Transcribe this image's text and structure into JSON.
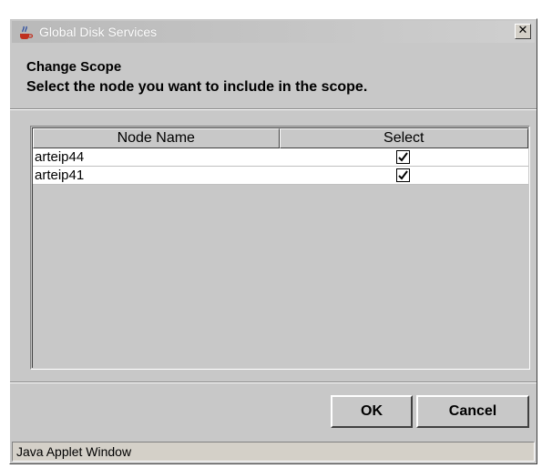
{
  "window": {
    "title": "Global Disk Services",
    "close_glyph": "✕",
    "icon": "java-coffee-cup-icon"
  },
  "dialog": {
    "heading": "Change Scope",
    "instruction": "Select the node you want to include in the scope."
  },
  "table": {
    "columns": [
      "Node Name",
      "Select"
    ],
    "rows": [
      {
        "node_name": "arteip44",
        "selected": true
      },
      {
        "node_name": "arteip41",
        "selected": true
      }
    ]
  },
  "buttons": {
    "ok_label": "OK",
    "cancel_label": "Cancel"
  },
  "status_bar": {
    "text": "Java Applet Window"
  },
  "colors": {
    "window_bg": "#c8c8c8",
    "title_text": "#ffffff",
    "row_bg": "#ffffff"
  }
}
